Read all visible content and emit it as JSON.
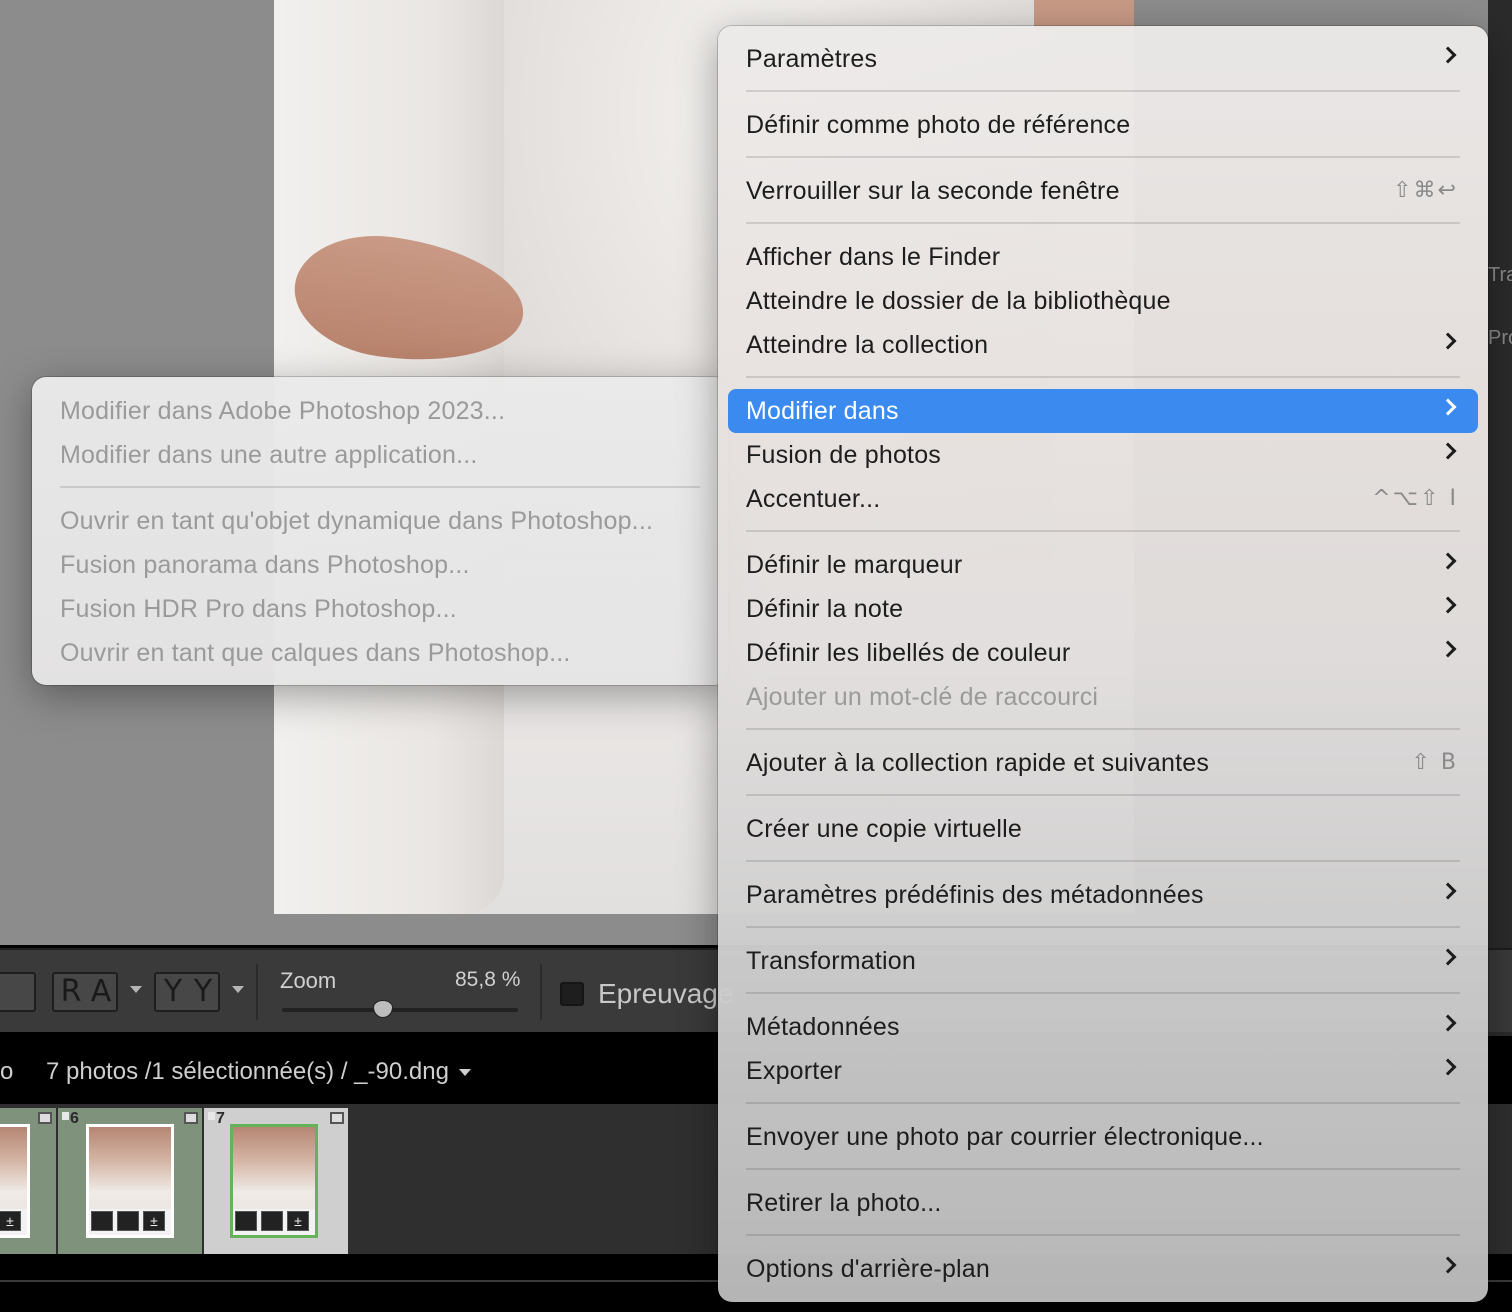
{
  "status_bar": {
    "selection_text": "7 photos /1 sélectionnée(s) / _-90.dng",
    "left_fragment": "o"
  },
  "toolbar": {
    "zoom_label": "Zoom",
    "zoom_value": "85,8 %",
    "zoom_fraction": 0.43,
    "proofing_label": "Epreuvage",
    "proofing_checked": false
  },
  "right_panel": {
    "fragment_1": "Tra",
    "fragment_2": "Pro"
  },
  "filmstrip": {
    "cells": [
      {
        "number": "",
        "selected": true,
        "active": false
      },
      {
        "number": "6",
        "selected": true,
        "active": false
      },
      {
        "number": "7",
        "selected": true,
        "active": true
      }
    ]
  },
  "context_menu": {
    "items": [
      {
        "label": "Paramètres",
        "submenu": true
      },
      {
        "label": "Définir comme photo de référence"
      },
      {
        "label": "Verrouiller sur la seconde fenêtre",
        "shortcut": "⇧⌘↩"
      },
      {
        "label": "Afficher dans le Finder"
      },
      {
        "label": "Atteindre le dossier de la bibliothèque"
      },
      {
        "label": "Atteindre la collection",
        "submenu": true
      },
      {
        "label": "Modifier dans",
        "submenu": true,
        "highlighted": true
      },
      {
        "label": "Fusion de photos",
        "submenu": true
      },
      {
        "label": "Accentuer...",
        "shortcut": "^⌥⇧ I"
      },
      {
        "label": "Définir le marqueur",
        "submenu": true
      },
      {
        "label": "Définir la note",
        "submenu": true
      },
      {
        "label": "Définir les libellés de couleur",
        "submenu": true
      },
      {
        "label": "Ajouter un mot-clé de raccourci",
        "disabled": true
      },
      {
        "label": "Ajouter à la collection rapide et suivantes",
        "shortcut": "⇧ B"
      },
      {
        "label": "Créer une copie virtuelle"
      },
      {
        "label": "Paramètres prédéfinis des métadonnées",
        "submenu": true
      },
      {
        "label": "Transformation",
        "submenu": true
      },
      {
        "label": "Métadonnées",
        "submenu": true
      },
      {
        "label": "Exporter",
        "submenu": true
      },
      {
        "label": "Envoyer une photo par courrier électronique..."
      },
      {
        "label": "Retirer la photo..."
      },
      {
        "label": "Options d'arrière-plan",
        "submenu": true
      }
    ]
  },
  "submenu": {
    "items": [
      {
        "label": "Modifier dans Adobe Photoshop 2023...",
        "disabled": true
      },
      {
        "label": "Modifier dans une autre application...",
        "disabled": true
      },
      {
        "label": "Ouvrir en tant qu'objet dynamique dans Photoshop...",
        "disabled": true
      },
      {
        "label": "Fusion panorama dans Photoshop...",
        "disabled": true
      },
      {
        "label": "Fusion HDR Pro dans Photoshop...",
        "disabled": true
      },
      {
        "label": "Ouvrir en tant que calques dans Photoshop...",
        "disabled": true
      }
    ]
  },
  "colors": {
    "highlight": "#3a8af0",
    "selected_cell": "#7e927c",
    "thumb_border_active": "#66b25a"
  }
}
